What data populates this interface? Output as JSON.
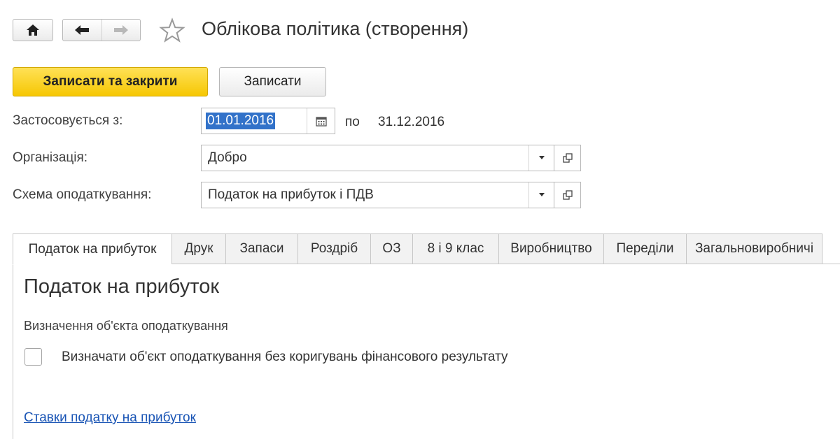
{
  "window": {
    "title": "Облікова політика (створення)",
    "icons": {
      "home": "home-icon",
      "back": "arrow-left-icon",
      "forward": "arrow-right-icon",
      "favorite": "star-icon"
    }
  },
  "toolbar": {
    "save_close_label": "Записати та закрити",
    "save_label": "Записати"
  },
  "form": {
    "applies_from_label": "Застосовується з:",
    "applies_from_value": "01.01.2016",
    "to_label": "по",
    "to_value": "31.12.2016",
    "organization_label": "Організація:",
    "organization_value": "Добро",
    "tax_scheme_label": "Схема оподаткування:",
    "tax_scheme_value": "Податок на прибуток і ПДВ"
  },
  "tabs": [
    {
      "label": "Податок на прибуток",
      "active": true
    },
    {
      "label": "Друк",
      "active": false
    },
    {
      "label": "Запаси",
      "active": false
    },
    {
      "label": "Роздріб",
      "active": false
    },
    {
      "label": "ОЗ",
      "active": false
    },
    {
      "label": "8 і 9 клас",
      "active": false
    },
    {
      "label": "Виробництво",
      "active": false
    },
    {
      "label": "Переділи",
      "active": false
    },
    {
      "label": "Загальновиробничі",
      "active": false
    }
  ],
  "tab_content": {
    "title": "Податок на прибуток",
    "group_label": "Визначення об'єкта оподаткування",
    "checkbox_label": "Визначати об'єкт оподаткування без коригувань фінансового результату",
    "checkbox_checked": false,
    "link_label": "Ставки податку на прибуток"
  },
  "colors": {
    "primary_button": "#f6c703",
    "selection": "#3272c9",
    "link": "#1a55b5"
  }
}
